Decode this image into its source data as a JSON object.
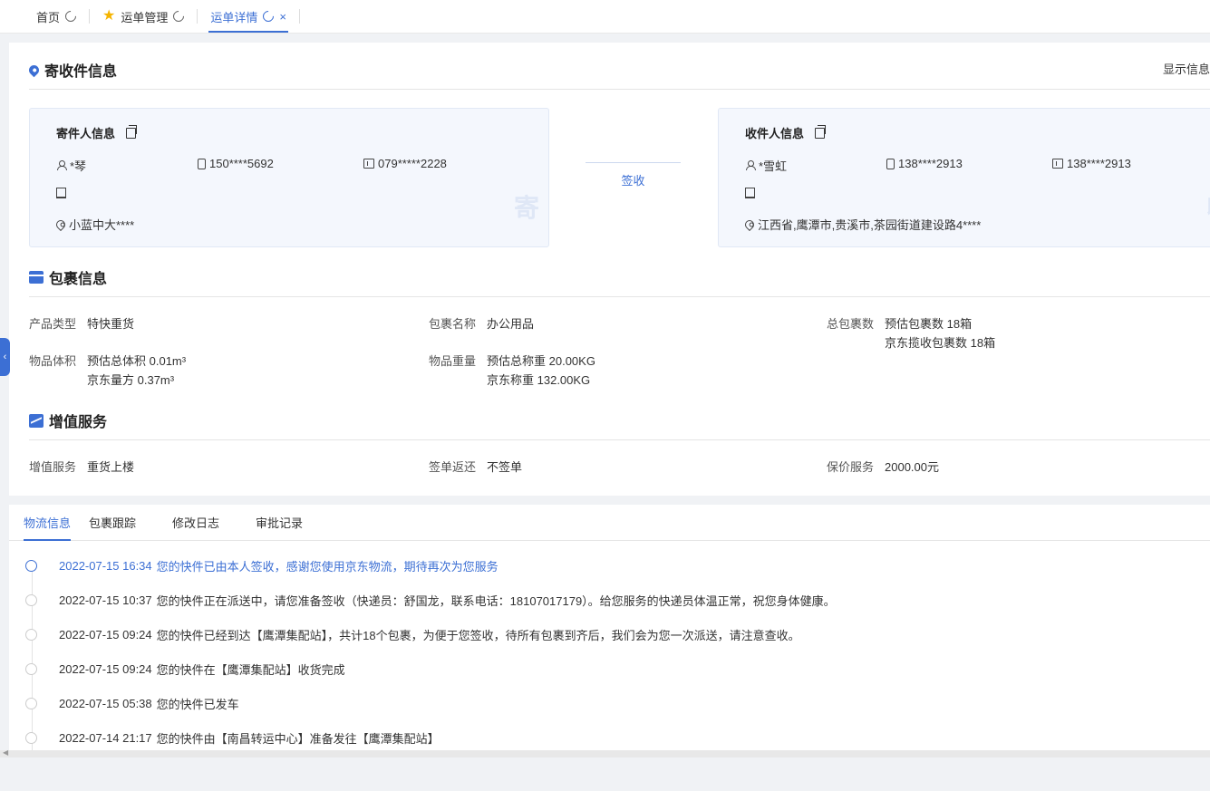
{
  "tabs": [
    {
      "label": "首页",
      "active": false
    },
    {
      "label": "运单管理",
      "active": false
    },
    {
      "label": "运单详情",
      "active": true
    }
  ],
  "address_section": {
    "title": "寄收件信息",
    "show_info": "显示信息",
    "sender": {
      "title": "寄件人信息",
      "name": "*琴",
      "mobile": "150****5692",
      "tel": "079*****2228",
      "company": "",
      "address": "小蓝中大****",
      "watermark": "寄"
    },
    "receiver": {
      "title": "收件人信息",
      "name": "*雪虹",
      "mobile": "138****2913",
      "tel": "138****2913",
      "company": "",
      "address": "江西省,鹰潭市,贵溪市,茶园街道建设路4****",
      "watermark": "收"
    },
    "status": "签收"
  },
  "package_section": {
    "title": "包裹信息",
    "product_type_label": "产品类型",
    "product_type": "特快重货",
    "package_name_label": "包裹名称",
    "package_name": "办公用品",
    "total_packages_label": "总包裹数",
    "total_packages_est": "预估包裹数 18箱",
    "total_packages_jd": "京东揽收包裹数 18箱",
    "volume_label": "物品体积",
    "volume_est": "预估总体积 0.01m³",
    "volume_jd": "京东量方 0.37m³",
    "weight_label": "物品重量",
    "weight_est": "预估总称重 20.00KG",
    "weight_jd": "京东称重 132.00KG"
  },
  "service_section": {
    "title": "增值服务",
    "service_label": "增值服务",
    "service": "重货上楼",
    "return_label": "签单返还",
    "return": "不签单",
    "insurance_label": "保价服务",
    "insurance": "2000.00元"
  },
  "logistics_tabs": [
    {
      "label": "物流信息",
      "active": true
    },
    {
      "label": "包裹跟踪",
      "active": false
    },
    {
      "label": "修改日志",
      "active": false
    },
    {
      "label": "审批记录",
      "active": false
    }
  ],
  "timeline": [
    {
      "time": "2022-07-15 16:34",
      "text": "您的快件已由本人签收，感谢您使用京东物流，期待再次为您服务",
      "current": true
    },
    {
      "time": "2022-07-15 10:37",
      "text": "您的快件正在派送中，请您准备签收（快递员：舒国龙，联系电话：18107017179）。给您服务的快递员体温正常，祝您身体健康。",
      "current": false
    },
    {
      "time": "2022-07-15 09:24",
      "text": "您的快件已经到达【鹰潭集配站】，共计18个包裹，为便于您签收，待所有包裹到齐后，我们会为您一次派送，请注意查收。",
      "current": false
    },
    {
      "time": "2022-07-15 09:24",
      "text": "您的快件在【鹰潭集配站】收货完成",
      "current": false
    },
    {
      "time": "2022-07-15 05:38",
      "text": "您的快件已发车",
      "current": false
    },
    {
      "time": "2022-07-14 21:17",
      "text": "您的快件由【南昌转运中心】准备发往【鹰潭集配站】",
      "current": false
    }
  ],
  "colors": {
    "accent": "#3c6fd4",
    "star": "#f5b400"
  }
}
